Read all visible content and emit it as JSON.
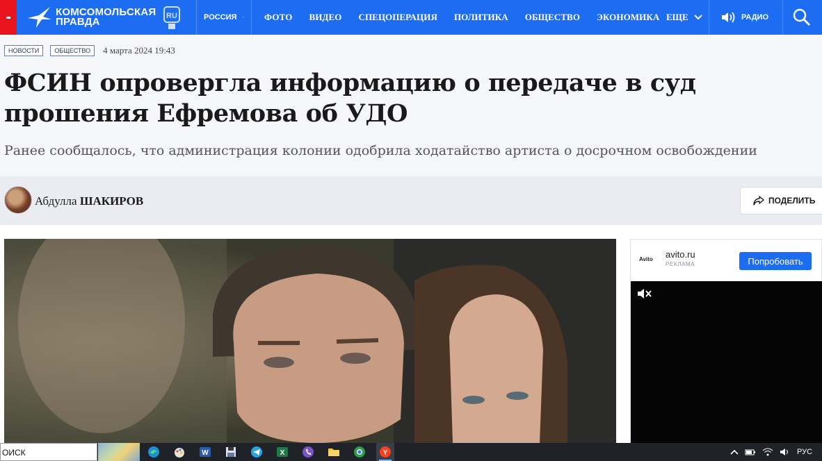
{
  "nav": {
    "logo_line1": "КОМСОМОЛЬСКАЯ",
    "logo_line2": "ПРАВДА",
    "logo_ru": "RU",
    "region": "РОССИЯ",
    "links": [
      "ФОТО",
      "ВИДЕО",
      "СПЕЦОПЕРАЦИЯ",
      "ПОЛИТИКА",
      "ОБЩЕСТВО",
      "ЭКОНОМИКА"
    ],
    "more": "ЕЩЕ",
    "radio": "РАДИО",
    "brand_color": "#1c6df2",
    "burger_color": "#e8141e"
  },
  "article": {
    "tags": [
      "НОВОСТИ",
      "ОБЩЕСТВО"
    ],
    "date": "4 марта 2024 19:43",
    "title": "ФСИН опровергла информацию о передаче в суд прошения Ефремова об УДО",
    "subtitle": "Ранее сообщалось, что администрация колонии одобрила ходатайство артиста о досрочном освобождении",
    "author_first": "Абдулла",
    "author_last": "ШАКИРОВ",
    "share_label": "ПОДЕЛИТЬ"
  },
  "ad": {
    "logo": "Avito",
    "site": "avito.ru",
    "label": "РЕКЛАМА",
    "button": "Попробовать"
  },
  "taskbar": {
    "search_text": "ОИСК",
    "apps": [
      "edge-icon",
      "paint-icon",
      "word-icon",
      "floppy-icon",
      "telegram-icon",
      "excel-icon",
      "viber-icon",
      "folder-icon",
      "chrome-icon",
      "yandex-icon"
    ],
    "language": "РУС"
  }
}
